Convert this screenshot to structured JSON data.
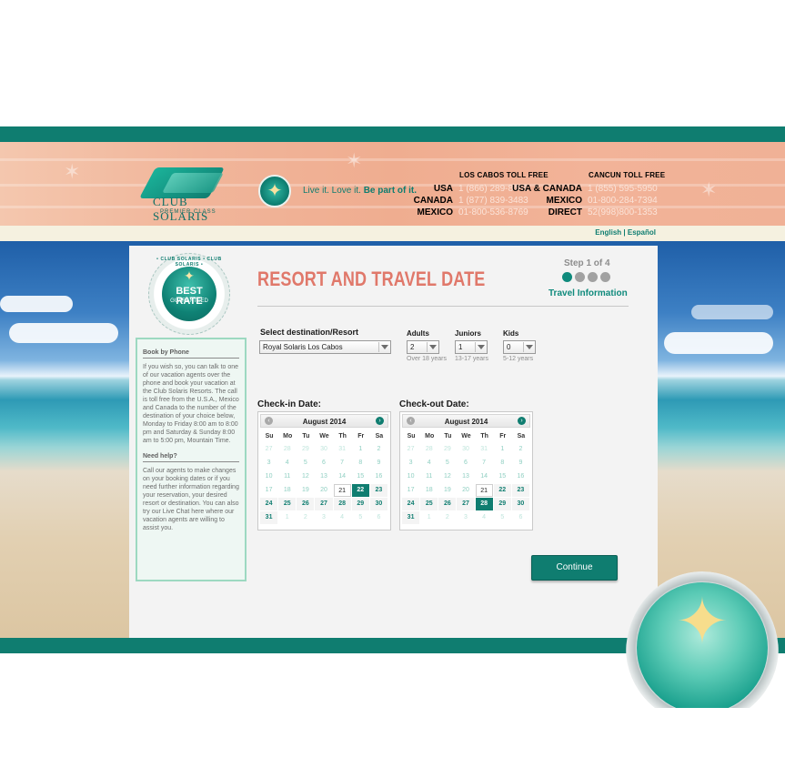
{
  "brand": {
    "logo_text": "CLUB SOLARIS",
    "logo_sub": "PREMIER CLASS",
    "tagline_plain": "Live it. Love it.",
    "tagline_bold": "Be part of it."
  },
  "phones": {
    "los_cabos": {
      "title": "LOS CABOS TOLL FREE",
      "rows": [
        {
          "label": "USA",
          "number": "1 (866) 289-8466"
        },
        {
          "label": "CANADA",
          "number": "1 (877) 839-3483"
        },
        {
          "label": "MEXICO",
          "number": "01-800-536-8769"
        }
      ]
    },
    "cancun": {
      "title": "CANCUN TOLL FREE",
      "rows": [
        {
          "label": "USA & CANADA",
          "number": "1 (855) 595-5950"
        },
        {
          "label": "MEXICO",
          "number": "01-800-284-7394"
        },
        {
          "label": "DIRECT",
          "number": "52(998)800-1353"
        }
      ]
    }
  },
  "language": {
    "english": "English",
    "separator": " | ",
    "spanish": "Español"
  },
  "badge": {
    "ring_text": "• CLUB SOLARIS • CLUB SOLARIS •",
    "title": "BEST RATE",
    "subtitle": "GUARANTEED"
  },
  "sidebar": {
    "book_heading": "Book by Phone",
    "book_text": "If you wish so, you can talk to one of our vacation agents over the phone and book your vacation at the Club Solaris Resorts. The call is toll free from the U.S.A., Mexico and Canada to the number of the destination of your choice below, Monday to Friday 8:00 am to 8:00 pm and Saturday & Sunday 8:00 am to 5:00 pm, Mountain Time.",
    "help_heading": "Need help?",
    "help_text": "Call our agents to make changes on your booking dates or if you need further information regarding your reservation, your desired resort or destination. You can also try our Live Chat here where our vacation agents are willing to assist you."
  },
  "form": {
    "title": "RESORT AND TRAVEL DATE",
    "step_label": "Step 1 of 4",
    "step_name": "Travel Information",
    "steps_total": 4,
    "step_current": 1,
    "destination": {
      "label": "Select destination/Resort",
      "value": "Royal Solaris Los Cabos"
    },
    "adults": {
      "label": "Adults",
      "value": "2",
      "hint": "Over 18 years"
    },
    "juniors": {
      "label": "Juniors",
      "value": "1",
      "hint": "13-17 years"
    },
    "kids": {
      "label": "Kids",
      "value": "0",
      "hint": "5-12 years"
    },
    "checkin_label": "Check-in Date:",
    "checkout_label": "Check-out Date:",
    "continue_label": "Continue"
  },
  "calendars": {
    "weekdays": [
      "Su",
      "Mo",
      "Tu",
      "We",
      "Th",
      "Fr",
      "Sa"
    ],
    "checkin": {
      "month": "August 2014",
      "prev_icon": "‹",
      "next_icon": "›",
      "selected": 22,
      "today": 21,
      "weeks": [
        [
          27,
          28,
          29,
          30,
          31,
          1,
          2
        ],
        [
          3,
          4,
          5,
          6,
          7,
          8,
          9
        ],
        [
          10,
          11,
          12,
          13,
          14,
          15,
          16
        ],
        [
          17,
          18,
          19,
          20,
          21,
          22,
          23
        ],
        [
          24,
          25,
          26,
          27,
          28,
          29,
          30
        ],
        [
          31,
          1,
          2,
          3,
          4,
          5,
          6
        ]
      ]
    },
    "checkout": {
      "month": "August 2014",
      "prev_icon": "‹",
      "next_icon": "›",
      "selected": 28,
      "today": 21,
      "weeks": [
        [
          27,
          28,
          29,
          30,
          31,
          1,
          2
        ],
        [
          3,
          4,
          5,
          6,
          7,
          8,
          9
        ],
        [
          10,
          11,
          12,
          13,
          14,
          15,
          16
        ],
        [
          17,
          18,
          19,
          20,
          21,
          22,
          23
        ],
        [
          24,
          25,
          26,
          27,
          28,
          29,
          30
        ],
        [
          31,
          1,
          2,
          3,
          4,
          5,
          6
        ]
      ]
    }
  },
  "colors": {
    "brand_teal": "#0f7d70",
    "title_coral": "#e0786a",
    "step_inactive": "#a1a1a1"
  },
  "icons": {
    "prev": "chevron-left-icon",
    "next": "chevron-right-icon",
    "dropdown": "chevron-down-icon",
    "compass": "compass-star-icon"
  }
}
